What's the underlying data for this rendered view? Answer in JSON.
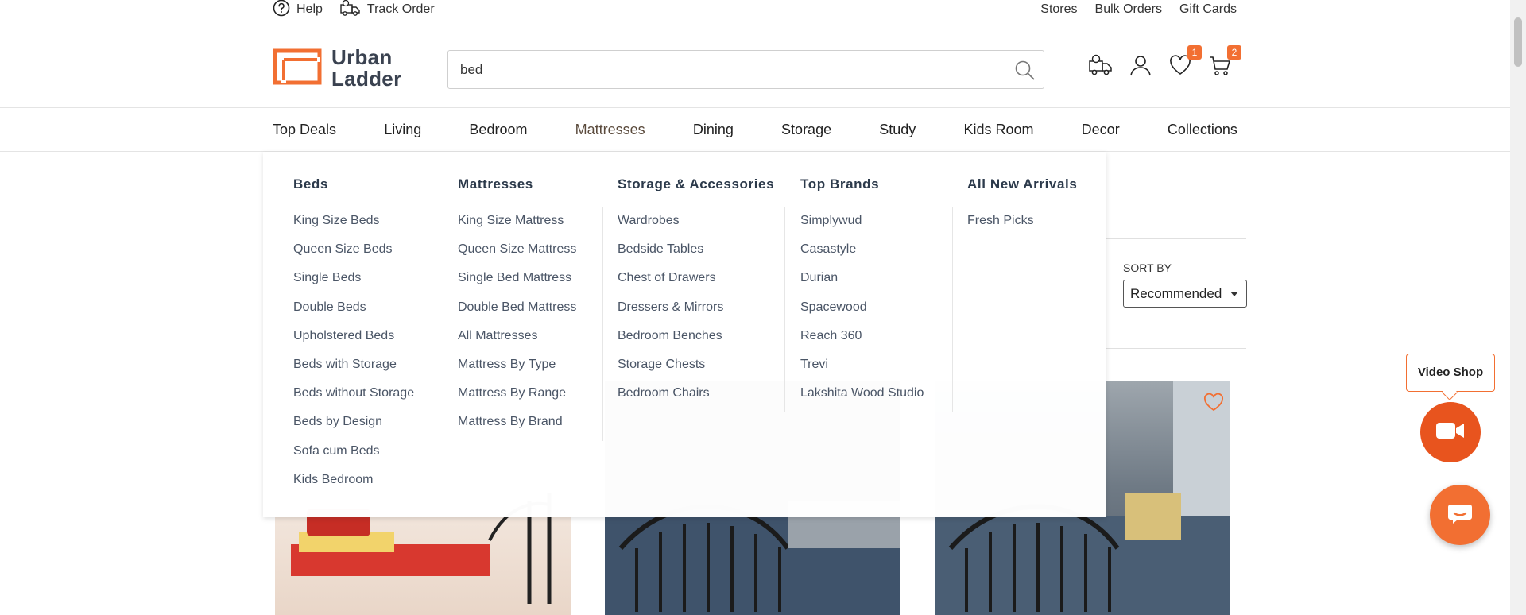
{
  "util": {
    "help": "Help",
    "track_order": "Track Order",
    "stores": "Stores",
    "bulk_orders": "Bulk Orders",
    "gift_cards": "Gift Cards"
  },
  "brand": {
    "line1": "Urban",
    "line2": "Ladder",
    "accent": "#f26f32"
  },
  "search": {
    "value": "bed"
  },
  "header_icons": {
    "wishlist_count": "1",
    "cart_count": "2"
  },
  "nav": [
    "Top Deals",
    "Living",
    "Bedroom",
    "Mattresses",
    "Dining",
    "Storage",
    "Study",
    "Kids Room",
    "Decor",
    "Collections"
  ],
  "mega_menu": [
    {
      "title": "Beds",
      "items": [
        "King Size Beds",
        "Queen Size Beds",
        "Single Beds",
        "Double Beds",
        "Upholstered Beds",
        "Beds with Storage",
        "Beds without Storage",
        "Beds by Design",
        "Sofa cum Beds",
        "Kids Bedroom"
      ]
    },
    {
      "title": "Mattresses",
      "items": [
        "King Size Mattress",
        "Queen Size Mattress",
        "Single Bed Mattress",
        "Double Bed Mattress",
        "All Mattresses",
        "Mattress By Type",
        "Mattress By Range",
        "Mattress By Brand"
      ]
    },
    {
      "title": "Storage & Accessories",
      "items": [
        "Wardrobes",
        "Bedside Tables",
        "Chest of Drawers",
        "Dressers & Mirrors",
        "Bedroom Benches",
        "Storage Chests",
        "Bedroom Chairs"
      ]
    },
    {
      "title": "Top Brands",
      "items": [
        "Simplywud",
        "Casastyle",
        "Durian",
        "Spacewood",
        "Reach 360",
        "Trevi",
        "Lakshita Wood Studio"
      ]
    },
    {
      "title": "All New Arrivals",
      "items": [
        "Fresh Picks"
      ]
    }
  ],
  "sort": {
    "label": "SORT BY",
    "selected": "Recommended"
  },
  "floating": {
    "video_shop": "Video Shop"
  }
}
